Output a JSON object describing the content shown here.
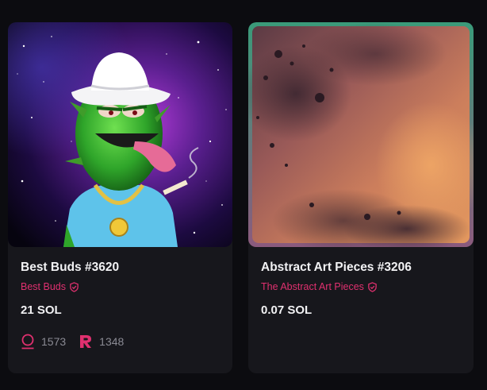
{
  "theme": {
    "accent": "#e0306f",
    "background": "#0c0c10",
    "card": "#17171c"
  },
  "cards": [
    {
      "title": "Best Buds #3620",
      "collection": "Best Buds",
      "price": "21 SOL",
      "stat_a": "1573",
      "stat_a_icon": "holder-icon",
      "stat_b": "1348",
      "stat_b_icon": "rarity-icon",
      "image": "cannabis-character-artwork"
    },
    {
      "title": "Abstract Art Pieces #3206",
      "collection": "The Abstract Art Pieces",
      "price": "0.07 SOL",
      "image": "abstract-watercolor-artwork"
    }
  ]
}
